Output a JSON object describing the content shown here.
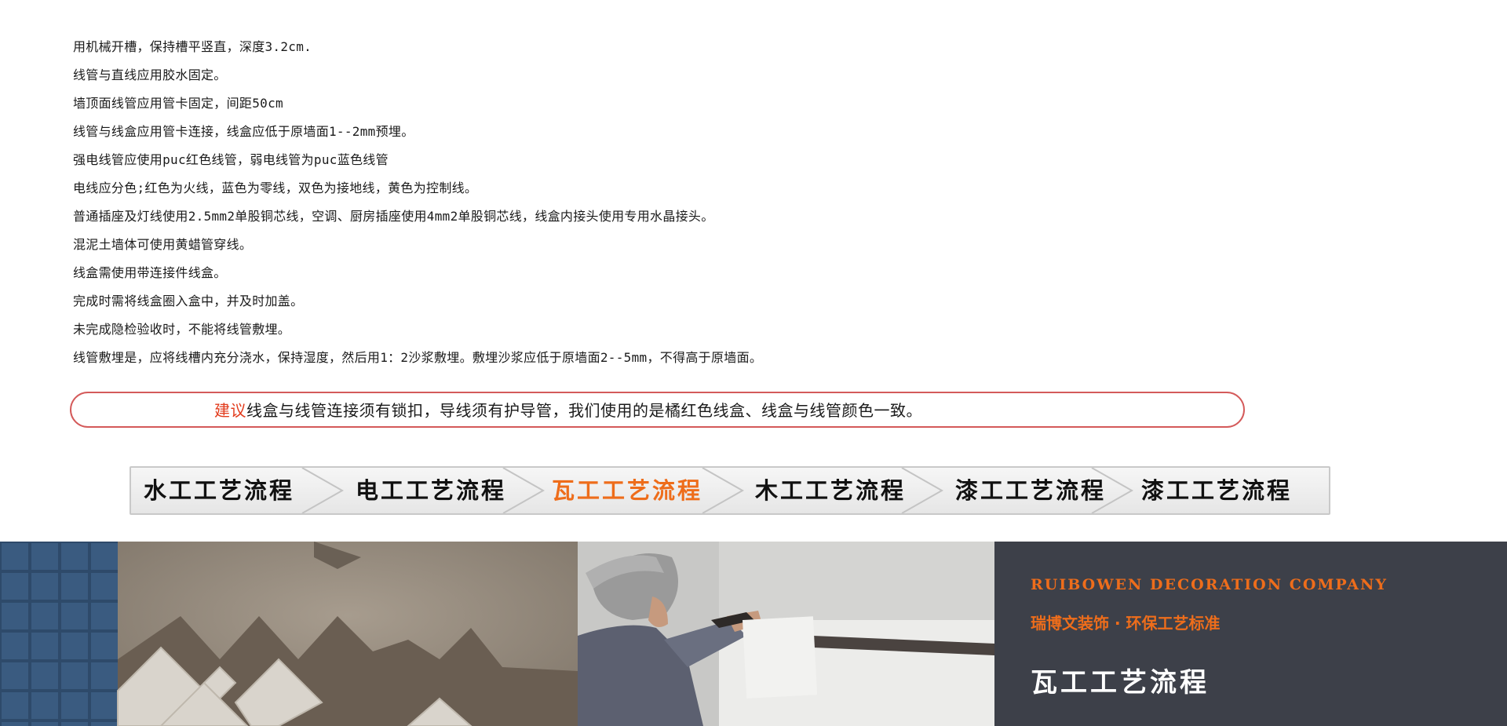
{
  "rules": [
    "用机械开槽，保持槽平竖直，深度3.2cm.",
    "线管与直线应用胶水固定。",
    "墙顶面线管应用管卡固定，间距50cm",
    "线管与线盒应用管卡连接，线盒应低于原墙面1--2mm预埋。",
    "强电线管应使用puc红色线管，弱电线管为puc蓝色线管",
    "电线应分色;红色为火线，蓝色为零线，双色为接地线，黄色为控制线。",
    "普通插座及灯线使用2.5mm2单股铜芯线，空调、厨房插座使用4mm2单股铜芯线，线盒内接头使用专用水晶接头。",
    "混泥土墙体可使用黄蜡管穿线。",
    "线盒需使用带连接件线盒。",
    "完成时需将线盒圈入盒中，并及时加盖。",
    "未完成隐检验收时，不能将线管敷埋。",
    "线管敷埋是，应将线槽内充分浇水，保持湿度，然后用1：2沙浆敷埋。敷埋沙浆应低于原墙面2--5mm，不得高于原墙面。"
  ],
  "advice": {
    "label": "建议",
    "text": "线盒与线管连接须有锁扣，导线须有护导管，我们使用的是橘红色线盒、线盒与线管颜色一致。"
  },
  "process_tabs": [
    {
      "label": "水工工艺流程",
      "active": false
    },
    {
      "label": "电工工艺流程",
      "active": false
    },
    {
      "label": "瓦工工艺流程",
      "active": true
    },
    {
      "label": "木工工艺流程",
      "active": false
    },
    {
      "label": "漆工工艺流程",
      "active": false
    },
    {
      "label": "漆工工艺流程",
      "active": false
    }
  ],
  "banner": {
    "company_en": "RUIBOWEN DECORATION COMPANY",
    "company_cn": "瑞博文装饰 · 环保工艺标准",
    "section_title": "瓦工工艺流程"
  },
  "colors": {
    "accent": "#ee6d1b",
    "advice_border": "#d45a5a",
    "advice_label": "#e23b1c",
    "banner_dark": "#3d4049"
  }
}
